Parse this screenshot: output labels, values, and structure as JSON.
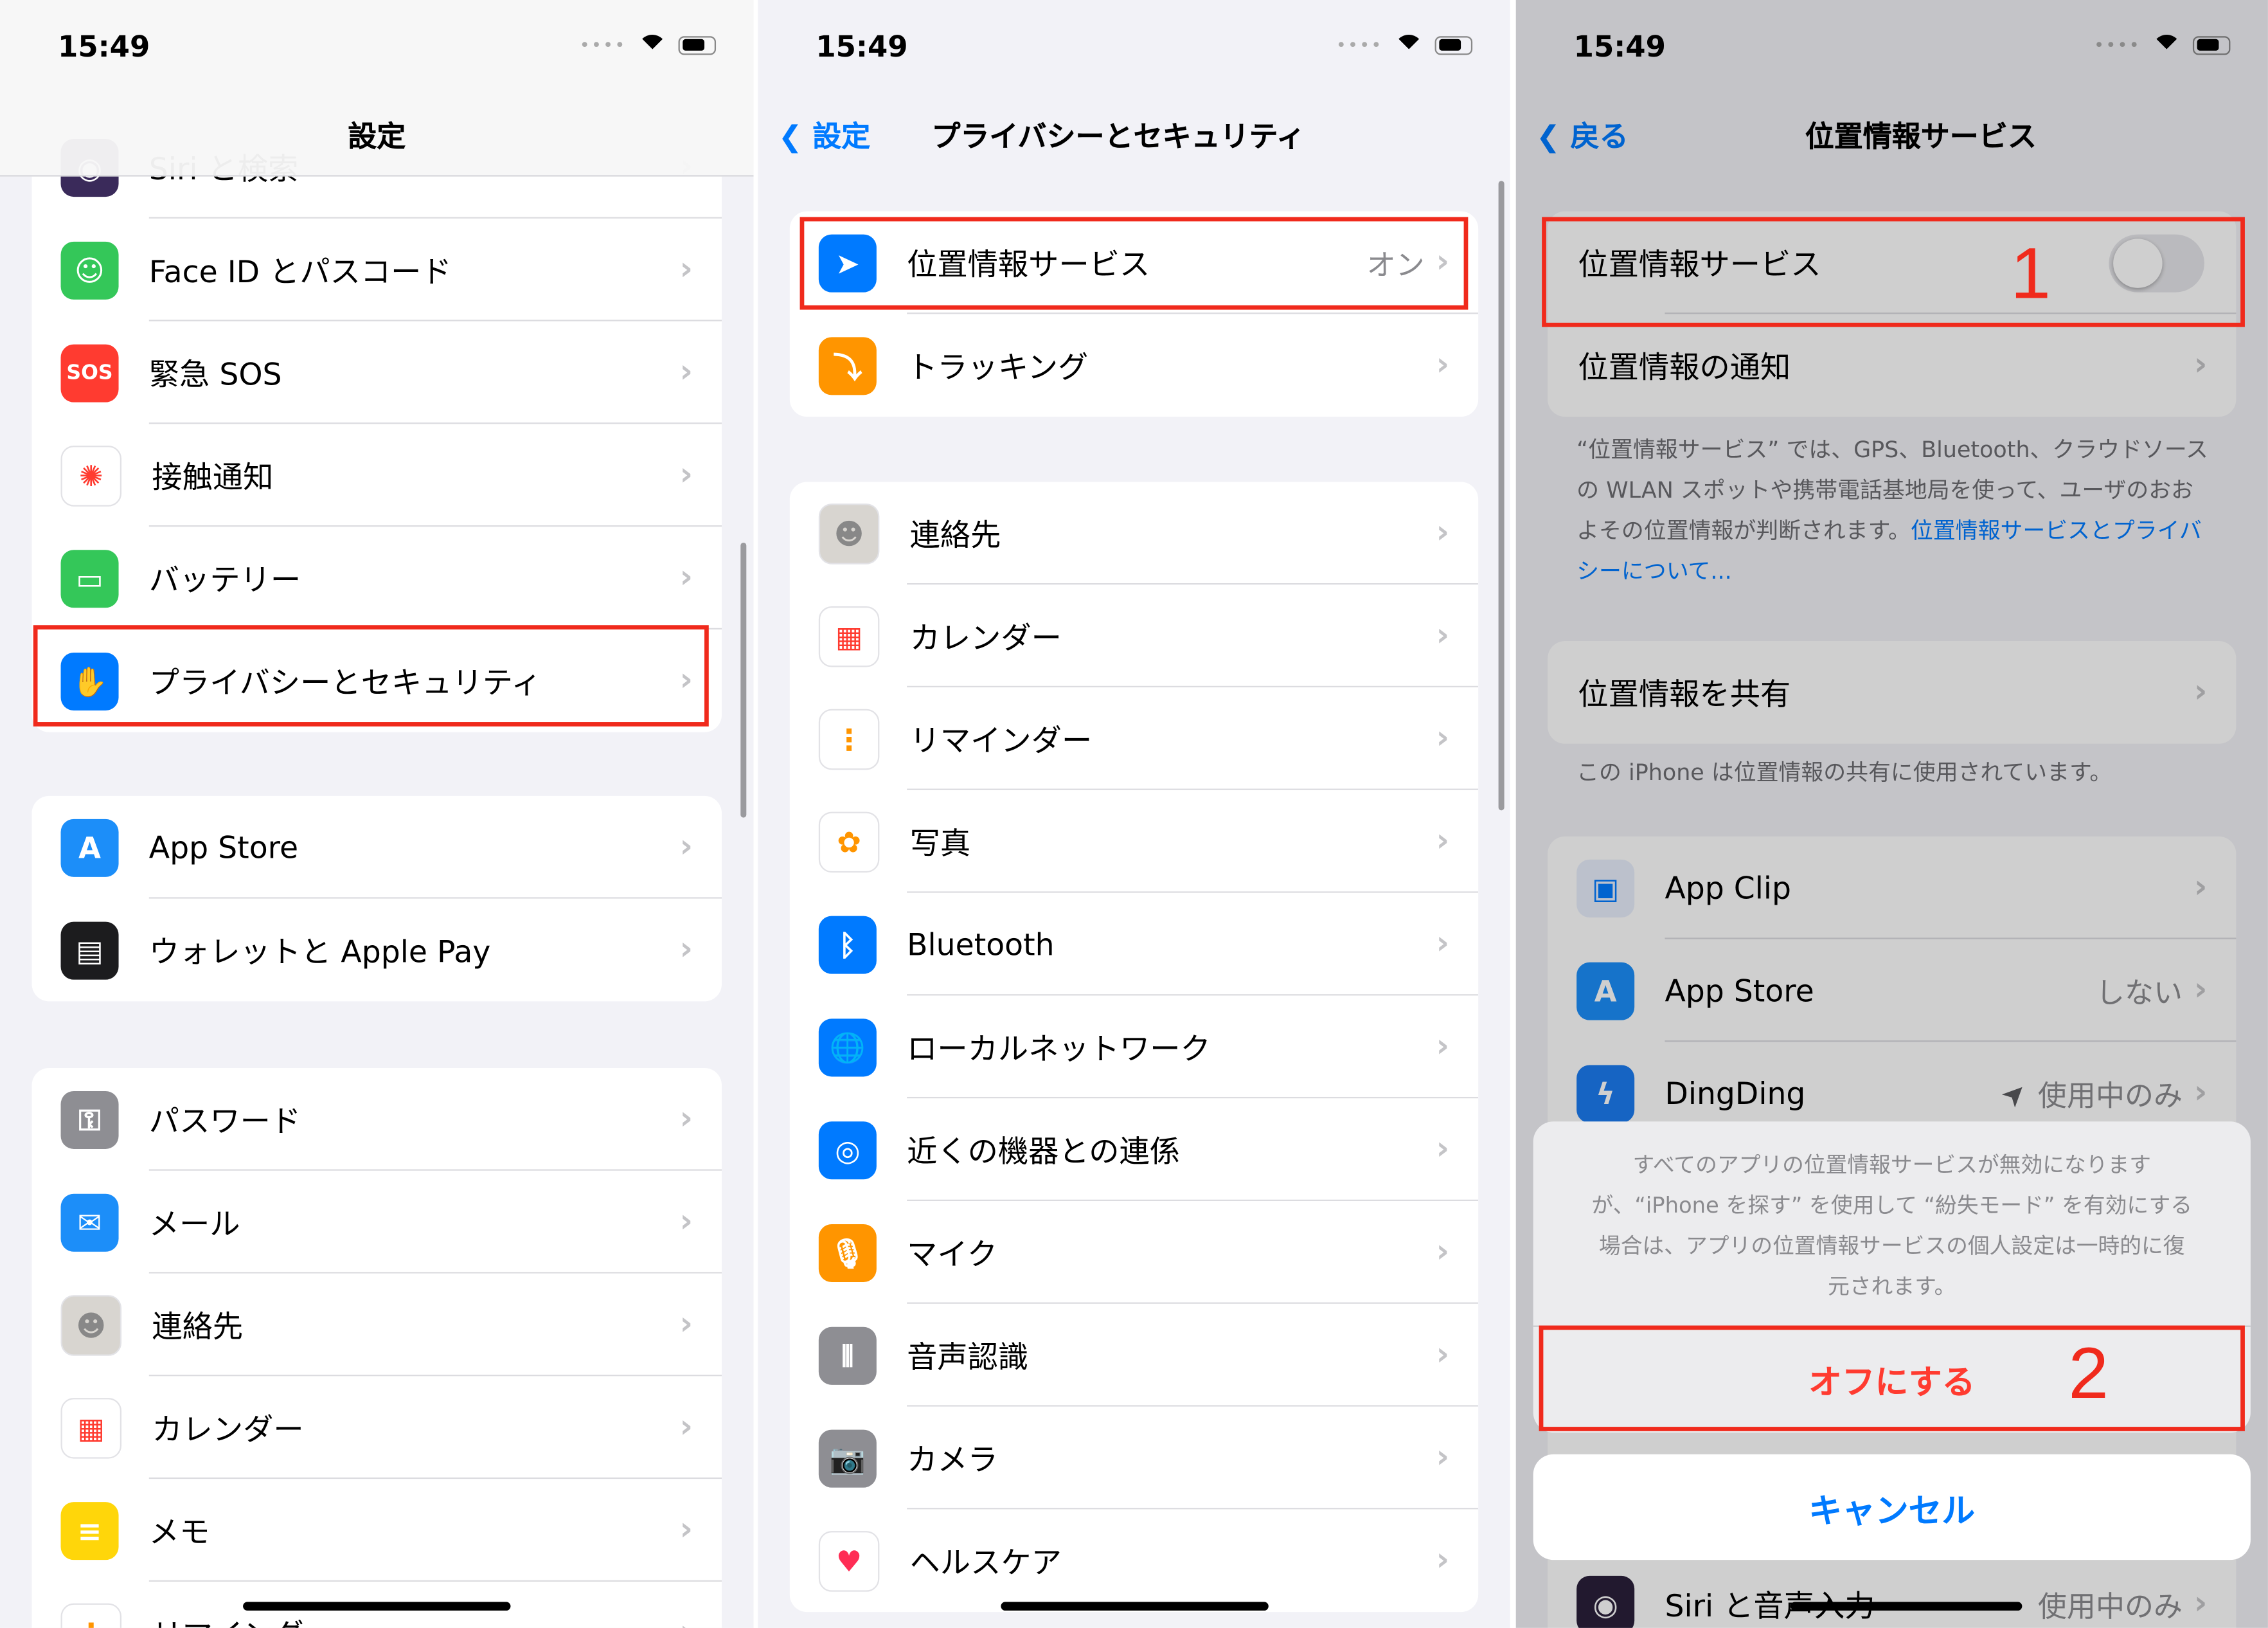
{
  "status": {
    "time": "15:49"
  },
  "colors": {
    "accent": "#007aff",
    "highlight": "#f02a1c",
    "destructive": "#ff3b30"
  },
  "panel1": {
    "title": "設定",
    "groups": [
      [
        {
          "label": "Siri と検索",
          "icon": "siri-icon",
          "color": "#3a2a5a",
          "glyph": "◉"
        },
        {
          "label": "Face ID とパスコード",
          "icon": "face-id-icon",
          "color": "#34c759",
          "glyph": "☺"
        },
        {
          "label": "緊急 SOS",
          "icon": "sos-icon",
          "color": "#ff3b30",
          "glyph": "SOS"
        },
        {
          "label": "接触通知",
          "icon": "exposure-icon",
          "color": "#ffffff",
          "glyph": "✺",
          "fg": "#ff3b30"
        },
        {
          "label": "バッテリー",
          "icon": "battery-icon",
          "color": "#34c759",
          "glyph": "▭"
        },
        {
          "label": "プライバシーとセキュリティ",
          "icon": "hand-icon",
          "color": "#007aff",
          "glyph": "✋"
        }
      ],
      [
        {
          "label": "App Store",
          "icon": "app-store-icon",
          "color": "#1c8ef9",
          "glyph": "A"
        },
        {
          "label": "ウォレットと Apple Pay",
          "icon": "wallet-icon",
          "color": "#1c1c1e",
          "glyph": "▤"
        }
      ],
      [
        {
          "label": "パスワード",
          "icon": "key-icon",
          "color": "#8e8e93",
          "glyph": "⚿"
        },
        {
          "label": "メール",
          "icon": "mail-icon",
          "color": "#1c8ef9",
          "glyph": "✉"
        },
        {
          "label": "連絡先",
          "icon": "contacts-icon",
          "color": "#d8d5d0",
          "glyph": "☻",
          "fg": "#888"
        },
        {
          "label": "カレンダー",
          "icon": "calendar-icon",
          "color": "#ffffff",
          "glyph": "▦",
          "fg": "#ff3b30"
        },
        {
          "label": "メモ",
          "icon": "notes-icon",
          "color": "#ffd60a",
          "glyph": "≡"
        },
        {
          "label": "リマインダー",
          "icon": "reminders-icon",
          "color": "#ffffff",
          "glyph": "⋮",
          "fg": "#ff9500"
        }
      ]
    ]
  },
  "panel2": {
    "back": "設定",
    "title": "プライバシーとセキュリティ",
    "groups": [
      [
        {
          "label": "位置情報サービス",
          "value": "オン",
          "icon": "location-arrow-icon",
          "color": "#007aff",
          "glyph": "➤"
        },
        {
          "label": "トラッキング",
          "icon": "tracking-icon",
          "color": "#ff9500",
          "glyph": "⤵"
        }
      ],
      [
        {
          "label": "連絡先",
          "icon": "contacts-icon",
          "color": "#d8d5d0",
          "glyph": "☻",
          "fg": "#888"
        },
        {
          "label": "カレンダー",
          "icon": "calendar-icon",
          "color": "#ffffff",
          "glyph": "▦",
          "fg": "#ff3b30"
        },
        {
          "label": "リマインダー",
          "icon": "reminders-icon",
          "color": "#ffffff",
          "glyph": "⋮",
          "fg": "#ff9500"
        },
        {
          "label": "写真",
          "icon": "photos-icon",
          "color": "#ffffff",
          "glyph": "✿",
          "fg": "#ff9500"
        },
        {
          "label": "Bluetooth",
          "icon": "bluetooth-icon",
          "color": "#007aff",
          "glyph": "ᛒ"
        },
        {
          "label": "ローカルネットワーク",
          "icon": "globe-icon",
          "color": "#007aff",
          "glyph": "🌐"
        },
        {
          "label": "近くの機器との連係",
          "icon": "nearby-icon",
          "color": "#007aff",
          "glyph": "◎"
        },
        {
          "label": "マイク",
          "icon": "microphone-icon",
          "color": "#ff9500",
          "glyph": "🎙"
        },
        {
          "label": "音声認識",
          "icon": "speech-icon",
          "color": "#8e8e93",
          "glyph": "⦀"
        },
        {
          "label": "カメラ",
          "icon": "camera-icon",
          "color": "#8e8e93",
          "glyph": "📷"
        },
        {
          "label": "ヘルスケア",
          "icon": "health-icon",
          "color": "#ffffff",
          "glyph": "♥",
          "fg": "#ff2d55"
        }
      ]
    ]
  },
  "panel3": {
    "back": "戻る",
    "title": "位置情報サービス",
    "toggle_label": "位置情報サービス",
    "toggle_on": false,
    "notify_label": "位置情報の通知",
    "footer_text": "“位置情報サービス” では、GPS、Bluetooth、クラウドソースの WLAN スポットや携帯電話基地局を使って、ユーザのおおよその位置情報が判断されます。",
    "footer_link": "位置情報サービスとプライバシーについて...",
    "share_label": "位置情報を共有",
    "share_note": "この iPhone は位置情報の共有に使用されています。",
    "apps": [
      {
        "label": "App Clip",
        "icon": "app-clip-icon",
        "color": "#e8eefc",
        "glyph": "▣",
        "fg": "#007aff"
      },
      {
        "label": "App Store",
        "value": "しない",
        "icon": "app-store-icon",
        "color": "#1c8ef9",
        "glyph": "A"
      },
      {
        "label": "DingDing",
        "value": "使用中のみ",
        "icon": "dingding-icon",
        "color": "#1c7cf0",
        "glyph": "ϟ",
        "arrow": true
      }
    ],
    "bottom_app": {
      "label": "Siri と音声入力",
      "value": "使用中のみ"
    },
    "sheet": {
      "message": "すべてのアプリの位置情報サービスが無効になりますが、“iPhone を探す” を使用して “紛失モード” を有効にする場合は、アプリの位置情報サービスの個人設定は一時的に復元されます。",
      "confirm": "オフにする",
      "cancel": "キャンセル"
    },
    "step1": "1",
    "step2": "2"
  }
}
